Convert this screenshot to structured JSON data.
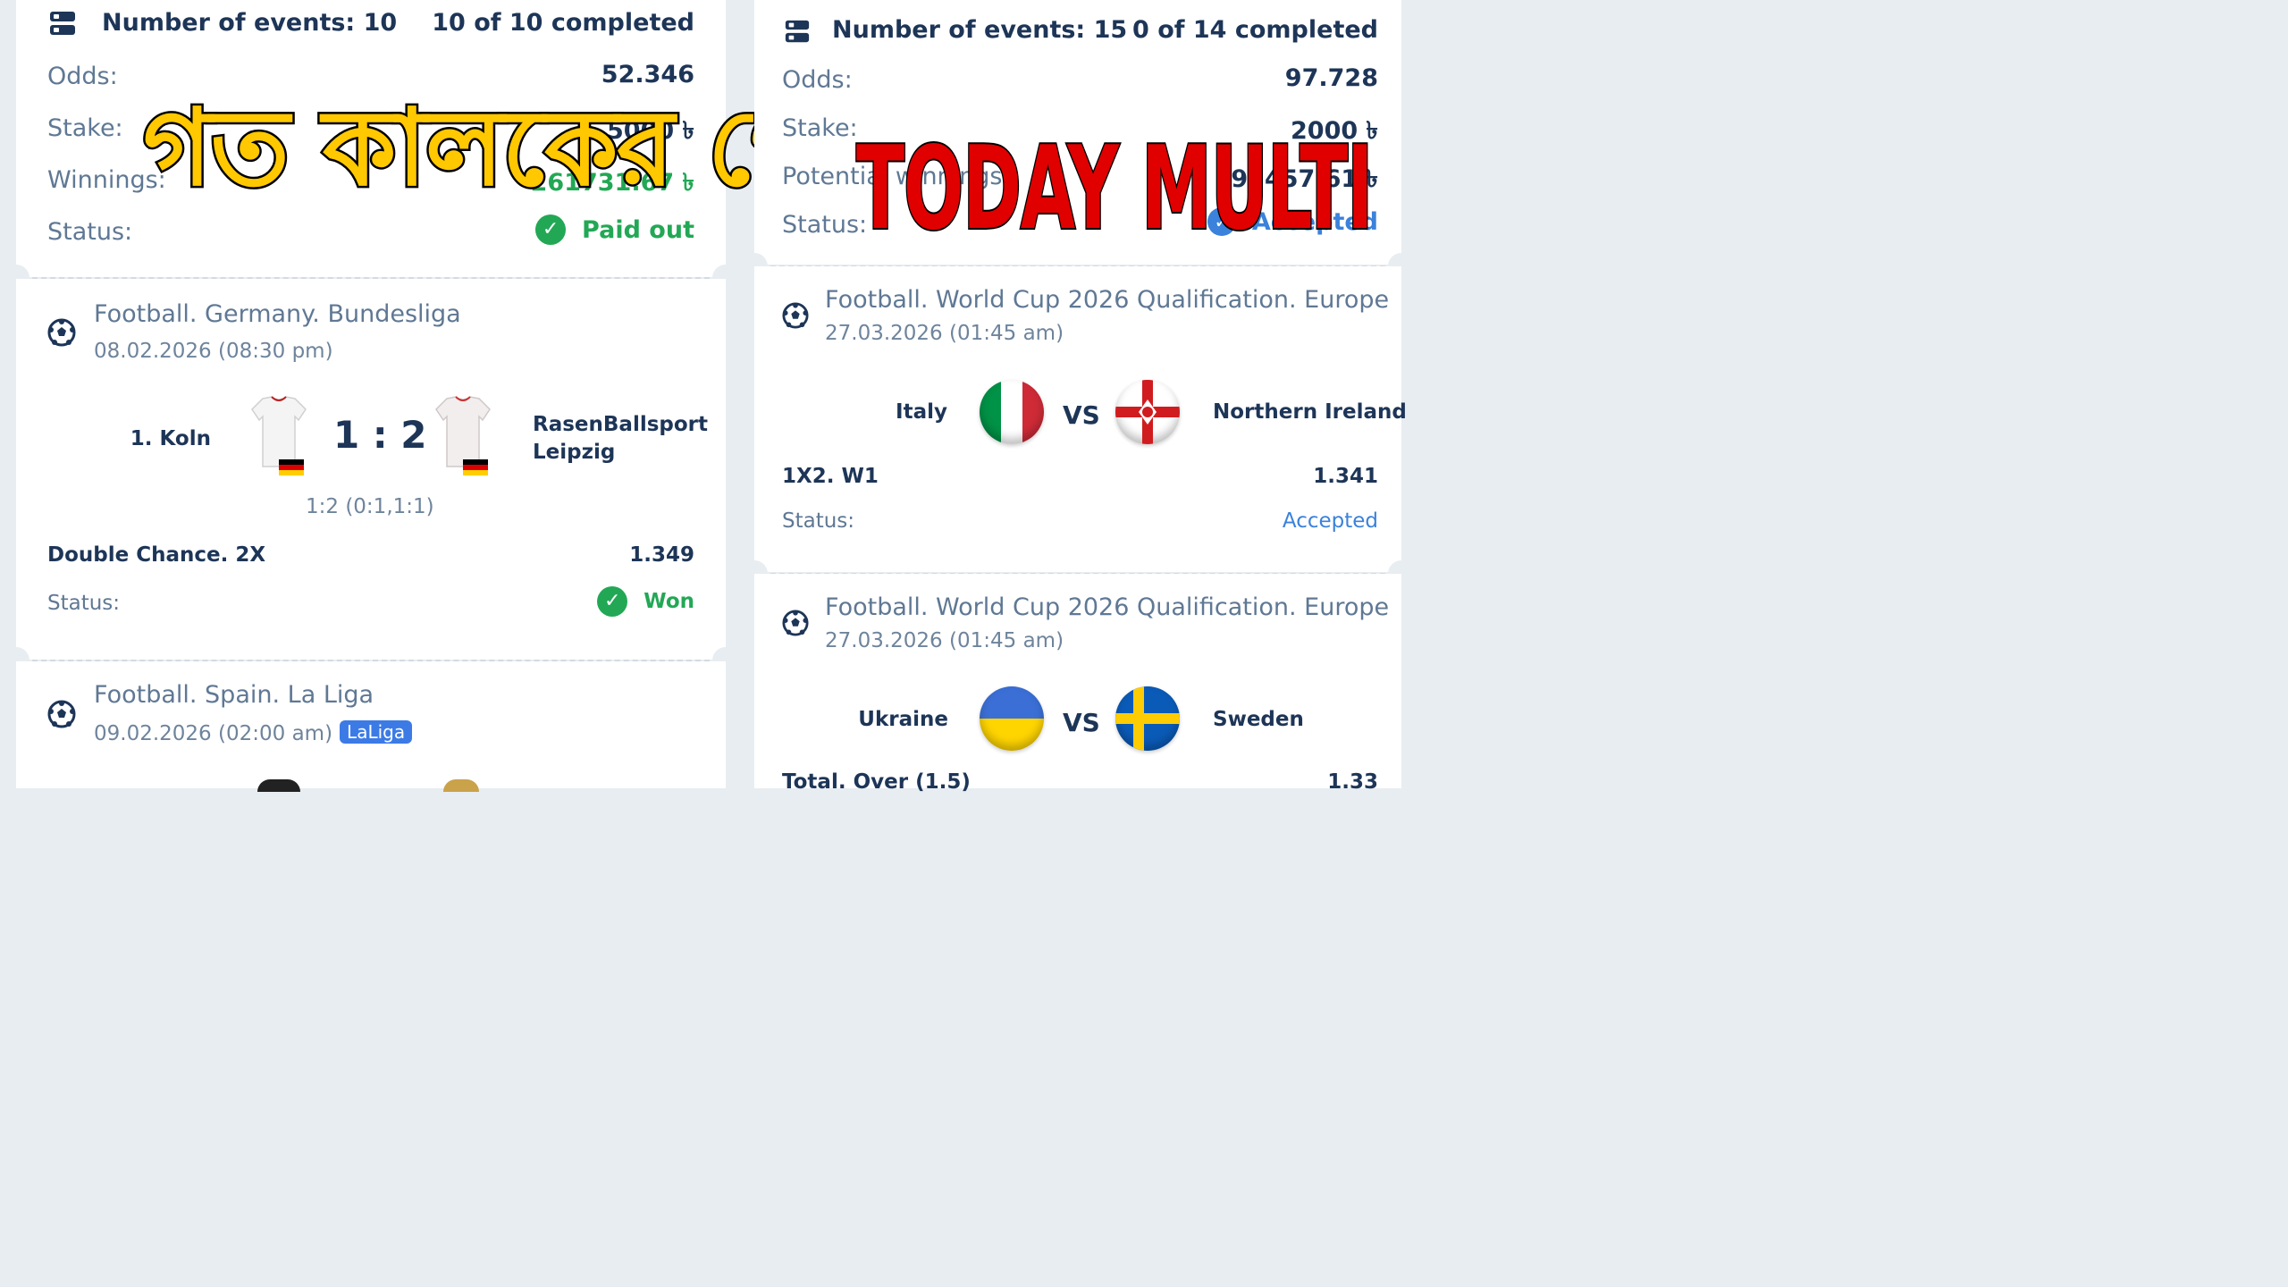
{
  "left": {
    "summary": {
      "events": "Number of events: 10",
      "completed": "10 of 10 completed",
      "odds_label": "Odds:",
      "odds": "52.346",
      "stake_label": "Stake:",
      "stake": "5000 ৳",
      "winnings_label": "Winnings:",
      "winnings": "261731.67 ৳",
      "status_label": "Status:",
      "status": "Paid out"
    },
    "event1": {
      "league": "Football. Germany. Bundesliga",
      "date": "08.02.2026 (08:30 pm)",
      "home": "1. Koln",
      "score": "1 : 2",
      "away_line1": "RasenBallsport",
      "away_line2": "Leipzig",
      "detail": "1:2 (0:1,1:1)",
      "market": "Double Chance. 2X",
      "odds": "1.349",
      "status_label": "Status:",
      "status": "Won"
    },
    "event2": {
      "league": "Football. Spain. La Liga",
      "date": "09.02.2026 (02:00 am)",
      "tag": "LaLiga"
    }
  },
  "right": {
    "summary": {
      "events": "Number of events: 15",
      "completed": "0 of 14 completed",
      "odds_label": "Odds:",
      "odds": "97.728",
      "stake_label": "Stake:",
      "stake": "2000 ৳",
      "winnings_label": "Potential winnings:",
      "winnings": "195457.61 ৳",
      "status_label": "Status:",
      "status": "Accepted"
    },
    "event1": {
      "league": "Football. World Cup 2026 Qualification. Europe",
      "date": "27.03.2026 (01:45 am)",
      "home": "Italy",
      "vs": "VS",
      "away": "Northern Ireland",
      "market": "1X2. W1",
      "odds": "1.341",
      "status_label": "Status:",
      "status": "Accepted"
    },
    "event2": {
      "league": "Football. World Cup 2026 Qualification. Europe",
      "date": "27.03.2026 (01:45 am)",
      "home": "Ukraine",
      "vs": "VS",
      "away": "Sweden",
      "market": "Total. Over (1.5)",
      "odds": "1.33"
    }
  },
  "overlays": {
    "bengali": "গত কালকের গেম",
    "english": "TODAY MULTI"
  },
  "colors": {
    "accent_blue": "#3a82db",
    "won_green": "#22a855",
    "overlay_yellow": "#ffc800",
    "overlay_red": "#e00000"
  },
  "icons": [
    "ticket-icon",
    "football-icon",
    "check-circle-icon",
    "jersey-icon",
    "flag-icon"
  ]
}
